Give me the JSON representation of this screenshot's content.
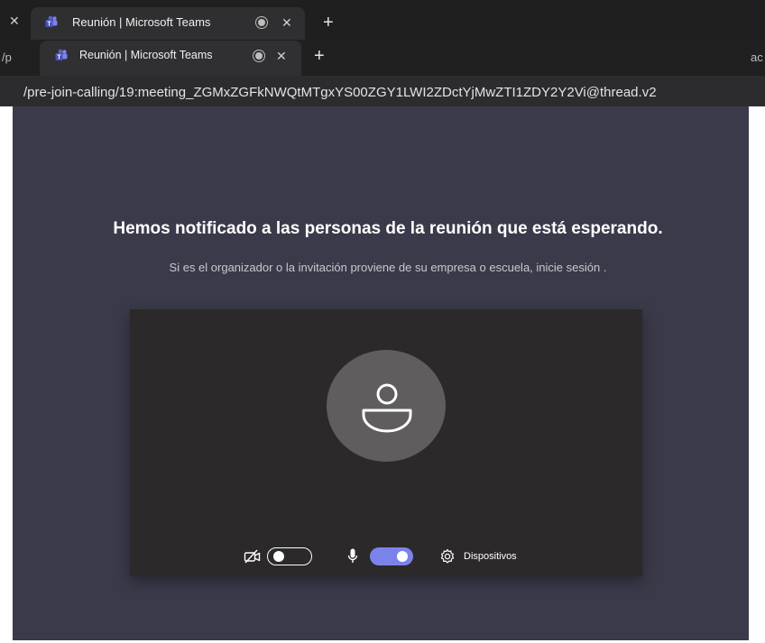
{
  "outer_browser": {
    "tab": {
      "title": "Reunión | Microsoft Teams",
      "icon": "microsoft-teams-icon",
      "status_icon": "recording-dot-icon",
      "close_icon": "close-icon"
    },
    "prev_tab_close_icon": "close-icon",
    "new_tab_icon": "plus-icon"
  },
  "inner_browser": {
    "tab": {
      "title": "Reunión | Microsoft Teams",
      "icon": "microsoft-teams-icon",
      "status_icon": "recording-dot-icon",
      "close_icon": "close-icon"
    },
    "left_url_fragment": "/p",
    "right_url_fragment": "ac",
    "new_tab_icon": "plus-icon",
    "url": "/pre-join-calling/19:meeting_ZGMxZGFkNWQtMTgxYS00ZGY1LWI2ZDctYjMwZTI1ZDY2Y2Vi@thread.v2"
  },
  "prejoin": {
    "heading": "Hemos notificado a las personas de la reunión que está esperando.",
    "subtext": "Si es el organizador o la invitación proviene de su empresa o escuela, inicie sesión .",
    "avatar_icon": "user-avatar-icon",
    "controls": {
      "camera": {
        "icon": "camera-off-icon",
        "state": "off"
      },
      "microphone": {
        "icon": "microphone-icon",
        "state": "on"
      },
      "devices": {
        "icon": "gear-icon",
        "label": "Dispositivos"
      }
    }
  },
  "colors": {
    "background": "#3a3a4a",
    "video_card": "#2b2929",
    "accent_toggle": "#7b83eb",
    "avatar_circle": "#5f5d5e"
  }
}
